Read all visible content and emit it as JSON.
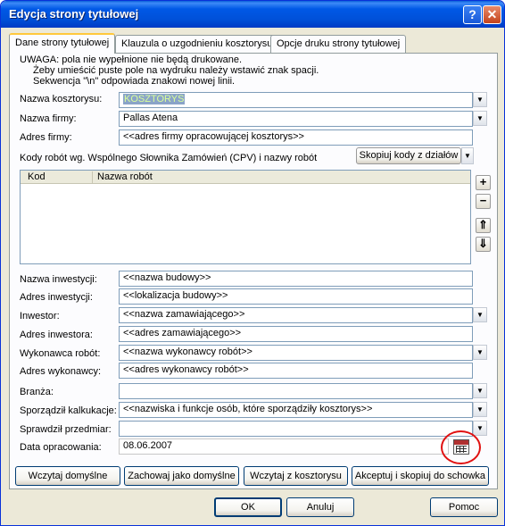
{
  "window": {
    "title": "Edycja strony tytułowej",
    "help_glyph": "?",
    "close_glyph": "✕"
  },
  "tabs": [
    {
      "label": "Dane strony tytułowej"
    },
    {
      "label": "Klauzula o uzgodnieniu kosztorysu"
    },
    {
      "label": "Opcje druku strony tytułowej"
    }
  ],
  "notice": {
    "line1": "UWAGA:  pola nie wypełnione nie będą drukowane.",
    "line2": "Żeby umieścić puste pole na wydruku należy wstawić znak spacji.",
    "line3": "Sekwencja \"\\n\" odpowiada znakowi nowej linii."
  },
  "fields": {
    "nazwa_kosztorysu": {
      "label": "Nazwa kosztorysu:",
      "value": "KOSZTORYS"
    },
    "nazwa_firmy": {
      "label": "Nazwa firmy:",
      "value": "Pallas Atena"
    },
    "adres_firmy": {
      "label": "Adres firmy:",
      "value": "<<adres firmy opracowującej kosztorys>>"
    },
    "nazwa_inwestycji": {
      "label": "Nazwa inwestycji:",
      "value": "<<nazwa budowy>>"
    },
    "adres_inwestycji": {
      "label": "Adres inwestycji:",
      "value": "<<lokalizacja budowy>>"
    },
    "inwestor": {
      "label": "Inwestor:",
      "value": "<<nazwa zamawiającego>>"
    },
    "adres_inwestora": {
      "label": "Adres inwestora:",
      "value": "<<adres zamawiającego>>"
    },
    "wykonawca": {
      "label": "Wykonawca robót:",
      "value": "<<nazwa wykonawcy robót>>"
    },
    "adres_wykonawcy": {
      "label": "Adres wykonawcy:",
      "value": "<<adres wykonawcy robót>>"
    },
    "branza": {
      "label": "Branża:",
      "value": ""
    },
    "sporzadzil": {
      "label": "Sporządził kalkukacje:",
      "value": "<<nazwiska i funkcje osób, które sporządziły kosztorys>>"
    },
    "sprawdzil": {
      "label": "Sprawdził przedmiar:",
      "value": ""
    },
    "data": {
      "label": "Data opracowania:",
      "value": "08.06.2007"
    }
  },
  "cpv": {
    "section_label": "Kody robót wg. Wspólnego Słownika Zamówień (CPV) i nazwy robót",
    "copy_button": "Skopiuj kody z działów",
    "columns": [
      "Kod",
      "Nazwa robót"
    ],
    "add_glyph": "+",
    "remove_glyph": "−",
    "up_glyph": "⇑",
    "down_glyph": "⇓"
  },
  "panel_buttons": {
    "load_default": "Wczytaj domyślne",
    "save_default": "Zachowaj jako domyślne",
    "load_from": "Wczytaj z kosztorysu",
    "accept_copy": "Akceptuj i skopiuj do schowka"
  },
  "dialog_buttons": {
    "ok": "OK",
    "cancel": "Anuluj",
    "help": "Pomoc"
  },
  "colors": {
    "title_blue": "#0058e6",
    "annotation_red": "#e01010"
  }
}
